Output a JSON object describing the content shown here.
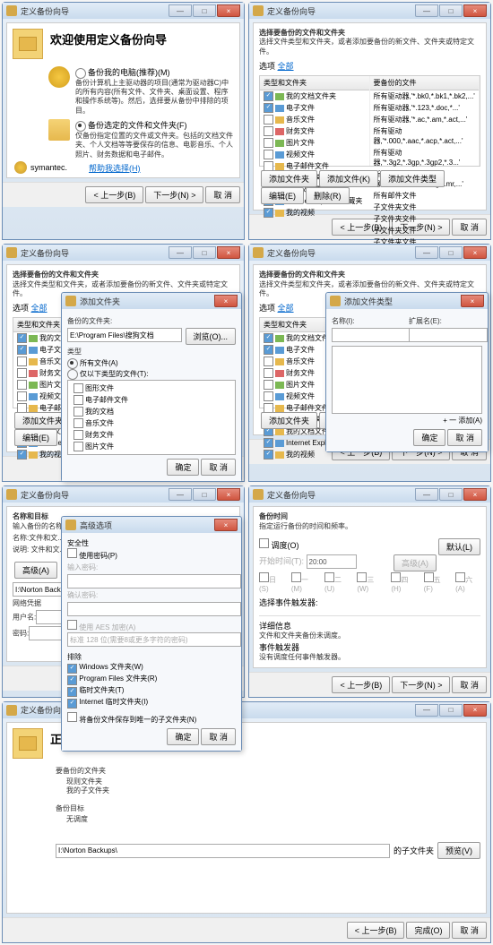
{
  "window_title": "定义备份向导",
  "ctrl": {
    "min": "—",
    "max": "□",
    "close": "×"
  },
  "btn": {
    "prev": "< 上一步(B)",
    "next": "下一步(N) >",
    "cancel": "取 消",
    "ok": "确定",
    "finish": "完成(O)",
    "add_folder": "添加文件夹",
    "add_file": "添加文件(K)",
    "add_type": "添加文件类型",
    "edit": "编辑(E)",
    "remove": "删除(R)",
    "browse": "浏览(O)...",
    "preview": "预览(V)",
    "advanced": "高级(A)",
    "default": "默认(L)"
  },
  "w1": {
    "heading": "欢迎使用定义备份向导",
    "opt1_label": "备份我的电脑(推荐)(M)",
    "opt1_desc": "备份计算机上主驱动器的项目(通常为驱动器C)中的所有内容(所有文件、文件夹、桌面设置、程序和操作系统等)。然后，选择要从备份中排除的项目。",
    "opt2_label": "备份选定的文件和文件夹(F)",
    "opt2_desc": "仅备份指定位置的文件或文件夹。包括的文档文件夹、个人文档等等要保存的信息、电影音乐、个人照片、财务数据和电子邮件。",
    "help": "帮助我选择(H)",
    "brand": "symantec."
  },
  "w2": {
    "heading": "选择要备份的文件和文件夹",
    "subheading": "选择文件类型和文件夹，或者添加要备份的新文件、文件夹或特定文件。",
    "options_link": "选项",
    "select_all_link": "全部",
    "col1": "类型和文件夹",
    "col2": "要备份的文件",
    "rows": [
      [
        "我的文档文件夹",
        "所有驱动器,'*.bk0,*.bk1,*.bk2,...'"
      ],
      [
        "电子文件",
        "所有驱动器,'*.123,*.doc,*...'"
      ],
      [
        "音乐文件",
        "所有驱动器,'*.ac,*.am,*.act,...'"
      ],
      [
        "财务文件",
        "所有驱动器,'*.000,*.aac,*.acp,*.act,...'"
      ],
      [
        "图片文件",
        "所有驱动器,'*.3g2,*.3gp,*.3gp2,*.3...'"
      ],
      [
        "视频文件",
        "所有驱动器,'*.dbs,*.ami,*.meg,*.mr,...'"
      ],
      [
        "电子邮件文件",
        "所有邮件文件"
      ],
      [
        "桌面文件夹",
        "子文件夹文件"
      ],
      [
        "我的文档文件夹",
        "子文件夹文件"
      ],
      [
        "Internet Explorer 收藏夹",
        "子文件夹文件"
      ],
      [
        "我的视频",
        "子文件夹文件"
      ]
    ]
  },
  "w3_modal": {
    "title": "添加文件夹",
    "label1": "备份的文件夹:",
    "path": "E:\\Program Files\\搜狗文档",
    "label2": "类型",
    "r1": "所有文件(A)",
    "r2": "仅以下类型的文件(T):",
    "types": [
      "图形文件",
      "电子邮件文件",
      "我的文档",
      "音乐文件",
      "财务文件",
      "图片文件"
    ]
  },
  "w4_modal": {
    "title": "添加文件类型",
    "label_name": "名称(I):",
    "label_ext": "扩展名(E):",
    "add": "+  一 添加(A)"
  },
  "w5": {
    "heading": "名称和目标",
    "subheading": "输入备份的名称并选择...",
    "label_name": "名称:文件和文...",
    "label_desc": "说明: 文件和文...",
    "target": "I:\\Norton Backups\\",
    "net_label": "网络凭据",
    "user": "用户名:",
    "pass": "密码:"
  },
  "w5_modal": {
    "title": "高级选项",
    "sec": "安全性",
    "use_pwd": "使用密码(P)",
    "pwd_label": "输入密码:",
    "confirm_label": "确认密码:",
    "aes": "使用 AES 加密(A)",
    "aes_opt": "标准 128 位(需要8或更多字符的密码)",
    "exclude": "排除",
    "ex1": "Windows 文件夹(W)",
    "ex2": "Program Files 文件夹(R)",
    "ex3": "临时文件夹(T)",
    "ex4": "Internet 临时文件夹(I)",
    "ex5": "将备份文件保存到唯一的子文件夹(N)"
  },
  "w6": {
    "heading": "备份时间",
    "subheading": "指定运行备份的时间和频率。",
    "none": "调度(O)",
    "start": "开始时间(T):",
    "time": "20:00",
    "days": [
      "日(S)",
      "一(M)",
      "二(U)",
      "三(W)",
      "四(H)",
      "五(F)",
      "六(A)"
    ],
    "trigger": "选择事件触发器:",
    "info": "详细信息",
    "info1": "文件和文件夹备份未调度。",
    "info2": "事件触发器",
    "info3": "没有调度任何事件触发器。"
  },
  "w7": {
    "heading": "正在完成定义备份向导",
    "sec1": "要备份的文件夹",
    "sec1_items": [
      "现则文件夹",
      "我的子文件夹"
    ],
    "sec2": "备份目标",
    "sec2_val": "无调度",
    "log": "I:\\Norton Backups\\",
    "sub": "的子文件夹"
  }
}
